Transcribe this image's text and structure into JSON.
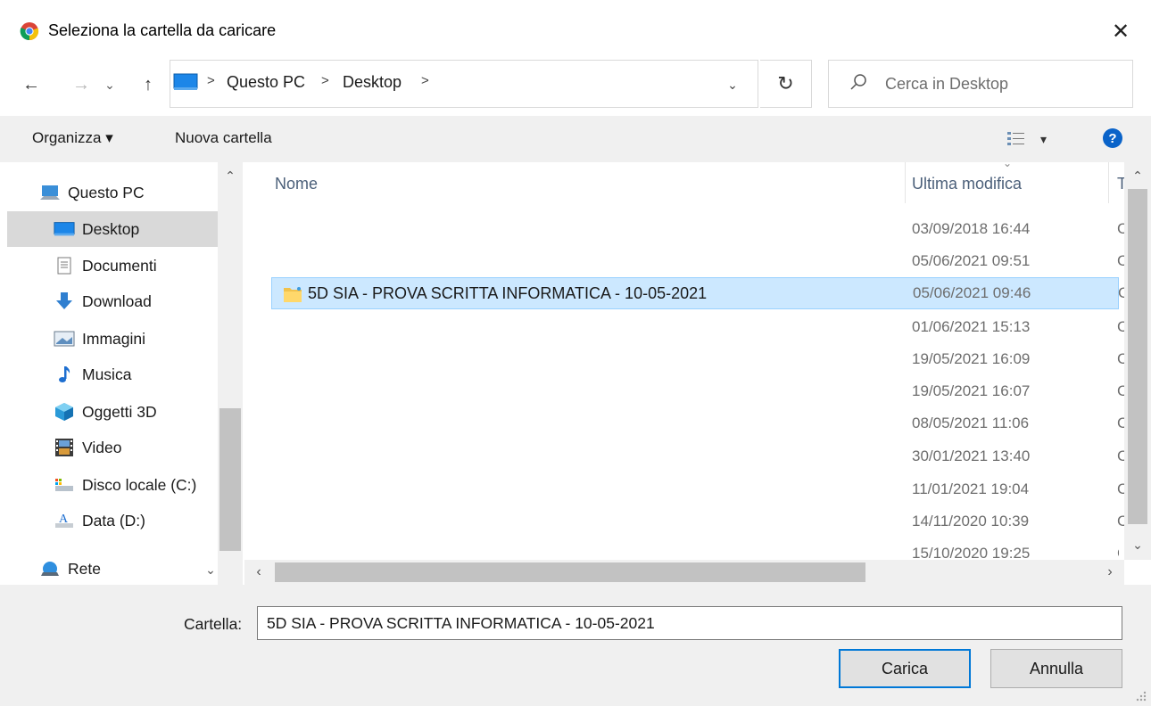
{
  "window": {
    "title": "Seleziona la cartella da caricare",
    "close_label": "✕"
  },
  "navigation": {
    "back": "←",
    "forward": "→",
    "recent": "⌄",
    "up": "↑"
  },
  "address_bar": {
    "breadcrumbs": [
      "Questo PC",
      "Desktop"
    ],
    "separator": ">",
    "refresh": "↻",
    "dropdown": "⌄"
  },
  "search": {
    "placeholder": "Cerca in Desktop"
  },
  "toolbar": {
    "organize_label": "Organizza ▾",
    "new_folder_label": "Nuova cartella",
    "view_dropdown": "▾",
    "help_label": "?"
  },
  "sidebar": {
    "items": [
      {
        "label": "Questo PC",
        "icon": "computer-icon",
        "selected": false
      },
      {
        "label": "Desktop",
        "icon": "desktop-icon",
        "selected": true
      },
      {
        "label": "Documenti",
        "icon": "documents-icon",
        "selected": false
      },
      {
        "label": "Download",
        "icon": "download-icon",
        "selected": false
      },
      {
        "label": "Immagini",
        "icon": "pictures-icon",
        "selected": false
      },
      {
        "label": "Musica",
        "icon": "music-icon",
        "selected": false
      },
      {
        "label": "Oggetti 3D",
        "icon": "3d-objects-icon",
        "selected": false
      },
      {
        "label": "Video",
        "icon": "video-icon",
        "selected": false
      },
      {
        "label": "Disco locale (C:)",
        "icon": "local-disk-icon",
        "selected": false
      },
      {
        "label": "Data (D:)",
        "icon": "drive-d-icon",
        "selected": false
      },
      {
        "label": "Rete",
        "icon": "network-icon",
        "selected": false
      }
    ]
  },
  "file_list": {
    "columns": {
      "name": "Nome",
      "modified": "Ultima modifica",
      "type": "T"
    },
    "rows": [
      {
        "name": "",
        "modified": "03/09/2018 16:44",
        "type": "C",
        "selected": false
      },
      {
        "name": "",
        "modified": "05/06/2021 09:51",
        "type": "C",
        "selected": false
      },
      {
        "name": "5D SIA - PROVA SCRITTA INFORMATICA - 10-05-2021",
        "modified": "05/06/2021 09:46",
        "type": "C",
        "selected": true
      },
      {
        "name": "",
        "modified": "01/06/2021 15:13",
        "type": "C",
        "selected": false
      },
      {
        "name": "",
        "modified": "19/05/2021 16:09",
        "type": "C",
        "selected": false
      },
      {
        "name": "",
        "modified": "19/05/2021 16:07",
        "type": "C",
        "selected": false
      },
      {
        "name": "",
        "modified": "08/05/2021 11:06",
        "type": "C",
        "selected": false
      },
      {
        "name": "",
        "modified": "30/01/2021 13:40",
        "type": "C",
        "selected": false
      },
      {
        "name": "",
        "modified": "11/01/2021 19:04",
        "type": "C",
        "selected": false
      },
      {
        "name": "",
        "modified": "14/11/2020 10:39",
        "type": "C",
        "selected": false
      },
      {
        "name": "",
        "modified": "15/10/2020 19:25",
        "type": "C",
        "selected": false
      }
    ]
  },
  "footer": {
    "folder_label": "Cartella:",
    "folder_value": "5D SIA - PROVA SCRITTA INFORMATICA - 10-05-2021",
    "upload_button": "Carica",
    "cancel_button": "Annulla"
  },
  "colors": {
    "accent": "#0078d7",
    "selection_bg": "#cce8ff",
    "selection_border": "#99d1ff",
    "toolbar_bg": "#f0f0f0"
  }
}
